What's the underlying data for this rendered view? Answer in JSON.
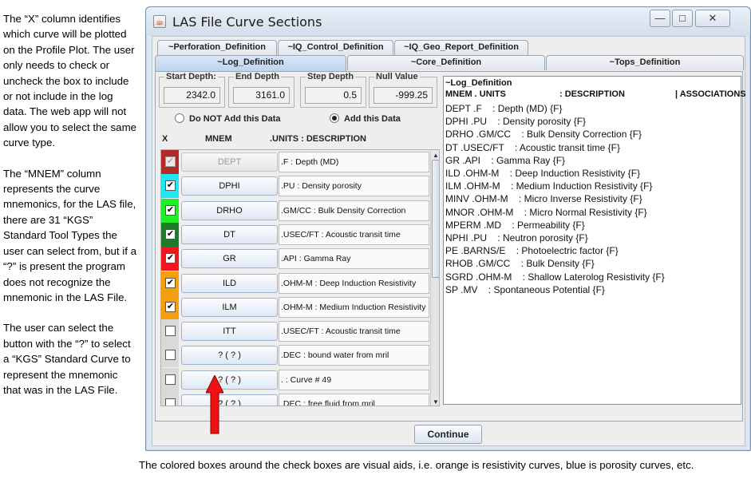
{
  "notes": {
    "x_column": "The “X” column identifies which curve will be plotted on the Profile Plot. The user only needs to check or uncheck the box to include or not include in the log data. The web app will not allow you to select the same curve type.",
    "mnem_column": "The “MNEM” column represents the curve mnemonics, for the LAS file, there are 31 “KGS” Standard Tool Types the user can select from, but if a “?” is present the program does not recognize the mnemonic in the LAS File.",
    "select_button": "The user can select the button with the “?” to select a “KGS” Standard Curve to represent the mnemonic that was in the LAS File.",
    "bottom": "The colored boxes around the check boxes are visual aids, i.e. orange is resistivity curves, blue is porosity curves, etc."
  },
  "window": {
    "title": "LAS File Curve Sections",
    "minimize": "—",
    "maximize": "□",
    "close": "✕",
    "icon": "java-app-icon"
  },
  "tabs": {
    "perforation": "~Perforation_Definition",
    "iq_control": "~IQ_Control_Definition",
    "iq_geo": "~IQ_Geo_Report_Definition",
    "log": "~Log_Definition",
    "core": "~Core_Definition",
    "tops": "~Tops_Definition"
  },
  "depth": {
    "start_label": "Start Depth:",
    "start_value": "2342.0",
    "end_label": "End Depth",
    "end_value": "3161.0",
    "step_label": "Step Depth",
    "step_value": "0.5",
    "null_label": "Null Value",
    "null_value": "-999.25"
  },
  "add_option": {
    "do_not_add": "Do NOT Add this Data",
    "add": "Add this Data",
    "selected": "add"
  },
  "columns": {
    "x": "X",
    "mnem": "MNEM",
    "units_desc": ".UNITS  : DESCRIPTION"
  },
  "curves": [
    {
      "checked": true,
      "enabled": false,
      "color": "#b22b2b",
      "mnem": "DEPT",
      "desc": ".F : Depth (MD)"
    },
    {
      "checked": true,
      "enabled": true,
      "color": "#1fe6ef",
      "mnem": "DPHI",
      "desc": ".PU : Density porosity"
    },
    {
      "checked": true,
      "enabled": true,
      "color": "#21ee2a",
      "mnem": "DRHO",
      "desc": ".GM/CC : Bulk Density Correction"
    },
    {
      "checked": true,
      "enabled": true,
      "color": "#1f7a2a",
      "mnem": "DT",
      "desc": ".USEC/FT : Acoustic transit time"
    },
    {
      "checked": true,
      "enabled": true,
      "color": "#f0181e",
      "mnem": "GR",
      "desc": ".API : Gamma Ray"
    },
    {
      "checked": true,
      "enabled": true,
      "color": "#f4a00e",
      "mnem": "ILD",
      "desc": ".OHM-M : Deep Induction Resistivity"
    },
    {
      "checked": true,
      "enabled": true,
      "color": "#f4a00e",
      "mnem": "ILM",
      "desc": ".OHM-M : Medium Induction Resistivity"
    },
    {
      "checked": false,
      "enabled": true,
      "color": "#d9d9d9",
      "mnem": "ITT",
      "desc": ".USEC/FT : Acoustic transit time"
    },
    {
      "checked": false,
      "enabled": true,
      "color": "#d9d9d9",
      "mnem": "? ( ? )",
      "desc": ".DEC : bound water from mril"
    },
    {
      "checked": false,
      "enabled": true,
      "color": "#d9d9d9",
      "mnem": "? ( ? )",
      "desc": ". : Curve # 49"
    },
    {
      "checked": false,
      "enabled": true,
      "color": "#d9d9d9",
      "mnem": "? ( ? )",
      "desc": ".DEC : free fluid from mril"
    }
  ],
  "textarea": {
    "heading": "~Log_Definition",
    "sub_mnem": "MNEM . UNITS",
    "sub_desc": ": DESCRIPTION",
    "sub_assoc": "| ASSOCIATIONS",
    "lines": [
      "DEPT .F    : Depth (MD) {F}",
      "DPHI .PU    : Density porosity {F}",
      "DRHO .GM/CC    : Bulk Density Correction {F}",
      "DT .USEC/FT    : Acoustic transit time {F}",
      "GR .API    : Gamma Ray {F}",
      "ILD .OHM-M    : Deep Induction Resistivity {F}",
      "ILM .OHM-M    : Medium Induction Resistivity {F}",
      "MINV .OHM-M    : Micro Inverse Resistivity {F}",
      "MNOR .OHM-M    : Micro Normal Resistivity {F}",
      "MPERM .MD    : Permeability {F}",
      "NPHI .PU    : Neutron porosity {F}",
      "PE .BARNS/E    : Photoelectric factor {F}",
      "RHOB .GM/CC    : Bulk Density {F}",
      "SGRD .OHM-M    : Shallow Laterolog Resistivity {F}",
      "SP .MV    : Spontaneous Potential {F}"
    ]
  },
  "continue_label": "Continue",
  "scroll": {
    "up": "▲",
    "down": "▼"
  }
}
